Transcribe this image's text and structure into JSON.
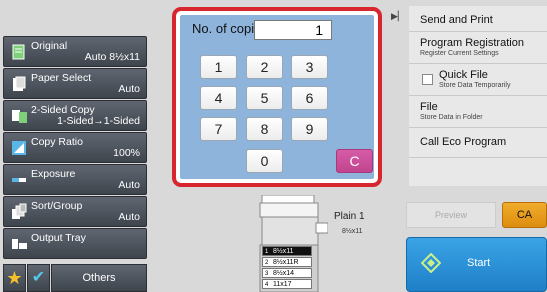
{
  "left_panel": {
    "items": [
      {
        "name": "Original",
        "value": "Auto  8½x11"
      },
      {
        "name": "Paper Select",
        "value": "Auto"
      },
      {
        "name": "2-Sided Copy",
        "value": "1-Sided→1-Sided"
      },
      {
        "name": "Copy Ratio",
        "value": "100%"
      },
      {
        "name": "Exposure",
        "value": "Auto"
      },
      {
        "name": "Sort/Group",
        "value": "Auto"
      },
      {
        "name": "Output Tray",
        "value": ""
      }
    ],
    "others_label": "Others"
  },
  "keypad": {
    "copies_label": "No. of copies",
    "copies_value": "1",
    "keys": [
      "1",
      "2",
      "3",
      "4",
      "5",
      "6",
      "7",
      "8",
      "9",
      "0"
    ],
    "clear_label": "C"
  },
  "machine": {
    "paper_label": "Plain 1",
    "paper_size": "8½x11",
    "trays": [
      {
        "num": "1",
        "size": "8½x11",
        "selected": true
      },
      {
        "num": "2",
        "size": "8½x11R",
        "selected": false
      },
      {
        "num": "3",
        "size": "8½x14",
        "selected": false
      },
      {
        "num": "4",
        "size": "11x17",
        "selected": false
      }
    ]
  },
  "right_panel": {
    "send_and_print": "Send and Print",
    "program_registration": "Program Registration",
    "program_registration_sub": "Register Current Settings",
    "quick_file": "Quick File",
    "quick_file_sub": "Store Data Temporarily",
    "file": "File",
    "file_sub": "Store Data in Folder",
    "call_eco": "Call Eco Program"
  },
  "actions": {
    "preview_label": "Preview",
    "ca_label": "CA",
    "start_label": "Start"
  },
  "colors": {
    "keypad_bg": "#8fb4dc",
    "highlight_frame": "#d8262f",
    "clear_key": "#c84b97",
    "ca_button": "#e79a1a",
    "start_button": "#2a8fd6"
  }
}
